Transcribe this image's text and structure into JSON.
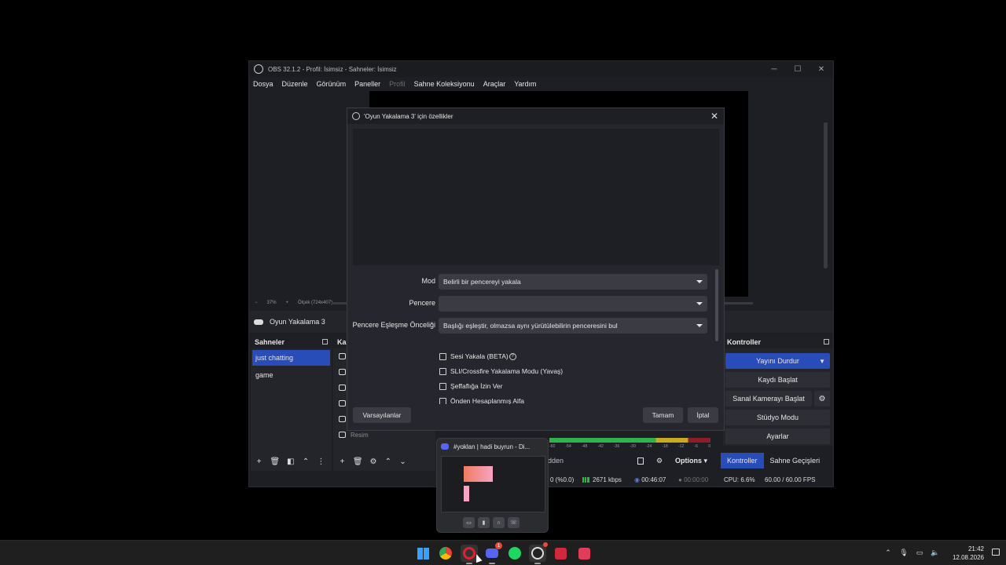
{
  "obs": {
    "title": "OBS 32.1.2 - Profil: İsimsiz - Sahneler: İsimsiz",
    "menu": [
      "Dosya",
      "Düzenle",
      "Görünüm",
      "Paneller",
      "Profil",
      "Sahne Koleksiyonu",
      "Araçlar",
      "Yardım"
    ],
    "zoom": {
      "minus": "−",
      "level": "37%",
      "plus": "+",
      "scale": "Ölçek (724x407)"
    },
    "selected_source": "Oyun Yakalama 3",
    "scenes": {
      "title": "Sahneler",
      "items": [
        "just chatting",
        "game"
      ]
    },
    "sources": {
      "title": "Ka",
      "last_item": "Resim"
    },
    "controls": {
      "title": "Kontroller",
      "stop_stream": "Yayını Durdur",
      "start_record": "Kaydı Başlat",
      "virtual_cam": "Sanal Kamerayı Başlat",
      "studio_mode": "Stüdyo Modu",
      "settings": "Ayarlar"
    },
    "bottom_tabs": [
      "Kontroller",
      "Sahne Geçişleri"
    ],
    "mixer": {
      "hidden_label": "dden",
      "options": "Options",
      "ticks": [
        "-60",
        "-54",
        "-48",
        "-42",
        "-36",
        "-30",
        "-24",
        "-18",
        "-12",
        "-6",
        "0"
      ]
    },
    "status": {
      "dropped": "0 (%0.0)",
      "bitrate": "2671 kbps",
      "stream_time": "00:46:07",
      "record_time": "00:00:00",
      "cpu": "CPU: 6.6%",
      "fps": "60.00 / 60.00 FPS"
    }
  },
  "dialog": {
    "title": "'Oyun Yakalama 3' için özellikler",
    "fields": [
      {
        "label": "Mod",
        "value": "Belirli bir pencereyi yakala"
      },
      {
        "label": "Pencere",
        "value": ""
      },
      {
        "label": "Pencere Eşleşme Önceliği",
        "value": "Başlığı eşleştir, olmazsa aynı yürütülebilirin penceresini bul"
      }
    ],
    "checkboxes": [
      "Sesi Yakala (BETA)",
      "SLI/Crossfire Yakalama Modu (Yavaş)",
      "Şeffaflığa İzin Ver",
      "Önden Hesaplanmış Alfa"
    ],
    "defaults_button": "Varsayılanlar",
    "ok_button": "Tamam",
    "cancel_button": "İptal"
  },
  "discord_popup": {
    "title": "#yoklan | hadi buyrun - Di..."
  },
  "taskbar": {
    "time": "21:42",
    "date": "12.08.2026",
    "discord_badge": "1"
  },
  "colors": {
    "accent": "#284cb8",
    "window_bg": "#1e1f24",
    "dialog_bg": "#26272e"
  }
}
